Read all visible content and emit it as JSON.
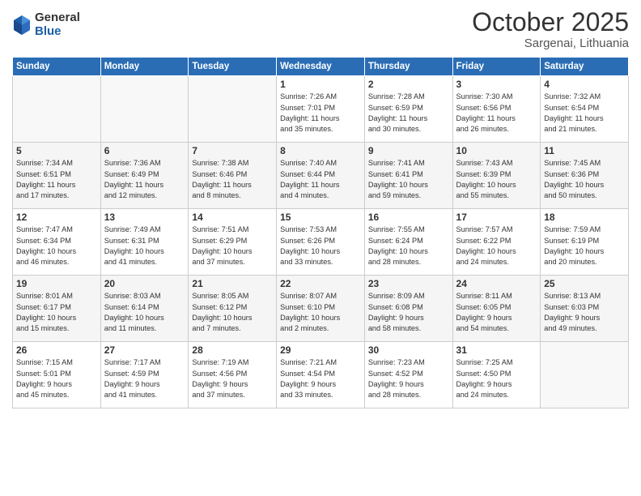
{
  "header": {
    "logo_general": "General",
    "logo_blue": "Blue",
    "month_title": "October 2025",
    "location": "Sargenai, Lithuania"
  },
  "days_of_week": [
    "Sunday",
    "Monday",
    "Tuesday",
    "Wednesday",
    "Thursday",
    "Friday",
    "Saturday"
  ],
  "weeks": [
    [
      {
        "day": "",
        "info": ""
      },
      {
        "day": "",
        "info": ""
      },
      {
        "day": "",
        "info": ""
      },
      {
        "day": "1",
        "info": "Sunrise: 7:26 AM\nSunset: 7:01 PM\nDaylight: 11 hours\nand 35 minutes."
      },
      {
        "day": "2",
        "info": "Sunrise: 7:28 AM\nSunset: 6:59 PM\nDaylight: 11 hours\nand 30 minutes."
      },
      {
        "day": "3",
        "info": "Sunrise: 7:30 AM\nSunset: 6:56 PM\nDaylight: 11 hours\nand 26 minutes."
      },
      {
        "day": "4",
        "info": "Sunrise: 7:32 AM\nSunset: 6:54 PM\nDaylight: 11 hours\nand 21 minutes."
      }
    ],
    [
      {
        "day": "5",
        "info": "Sunrise: 7:34 AM\nSunset: 6:51 PM\nDaylight: 11 hours\nand 17 minutes."
      },
      {
        "day": "6",
        "info": "Sunrise: 7:36 AM\nSunset: 6:49 PM\nDaylight: 11 hours\nand 12 minutes."
      },
      {
        "day": "7",
        "info": "Sunrise: 7:38 AM\nSunset: 6:46 PM\nDaylight: 11 hours\nand 8 minutes."
      },
      {
        "day": "8",
        "info": "Sunrise: 7:40 AM\nSunset: 6:44 PM\nDaylight: 11 hours\nand 4 minutes."
      },
      {
        "day": "9",
        "info": "Sunrise: 7:41 AM\nSunset: 6:41 PM\nDaylight: 10 hours\nand 59 minutes."
      },
      {
        "day": "10",
        "info": "Sunrise: 7:43 AM\nSunset: 6:39 PM\nDaylight: 10 hours\nand 55 minutes."
      },
      {
        "day": "11",
        "info": "Sunrise: 7:45 AM\nSunset: 6:36 PM\nDaylight: 10 hours\nand 50 minutes."
      }
    ],
    [
      {
        "day": "12",
        "info": "Sunrise: 7:47 AM\nSunset: 6:34 PM\nDaylight: 10 hours\nand 46 minutes."
      },
      {
        "day": "13",
        "info": "Sunrise: 7:49 AM\nSunset: 6:31 PM\nDaylight: 10 hours\nand 41 minutes."
      },
      {
        "day": "14",
        "info": "Sunrise: 7:51 AM\nSunset: 6:29 PM\nDaylight: 10 hours\nand 37 minutes."
      },
      {
        "day": "15",
        "info": "Sunrise: 7:53 AM\nSunset: 6:26 PM\nDaylight: 10 hours\nand 33 minutes."
      },
      {
        "day": "16",
        "info": "Sunrise: 7:55 AM\nSunset: 6:24 PM\nDaylight: 10 hours\nand 28 minutes."
      },
      {
        "day": "17",
        "info": "Sunrise: 7:57 AM\nSunset: 6:22 PM\nDaylight: 10 hours\nand 24 minutes."
      },
      {
        "day": "18",
        "info": "Sunrise: 7:59 AM\nSunset: 6:19 PM\nDaylight: 10 hours\nand 20 minutes."
      }
    ],
    [
      {
        "day": "19",
        "info": "Sunrise: 8:01 AM\nSunset: 6:17 PM\nDaylight: 10 hours\nand 15 minutes."
      },
      {
        "day": "20",
        "info": "Sunrise: 8:03 AM\nSunset: 6:14 PM\nDaylight: 10 hours\nand 11 minutes."
      },
      {
        "day": "21",
        "info": "Sunrise: 8:05 AM\nSunset: 6:12 PM\nDaylight: 10 hours\nand 7 minutes."
      },
      {
        "day": "22",
        "info": "Sunrise: 8:07 AM\nSunset: 6:10 PM\nDaylight: 10 hours\nand 2 minutes."
      },
      {
        "day": "23",
        "info": "Sunrise: 8:09 AM\nSunset: 6:08 PM\nDaylight: 9 hours\nand 58 minutes."
      },
      {
        "day": "24",
        "info": "Sunrise: 8:11 AM\nSunset: 6:05 PM\nDaylight: 9 hours\nand 54 minutes."
      },
      {
        "day": "25",
        "info": "Sunrise: 8:13 AM\nSunset: 6:03 PM\nDaylight: 9 hours\nand 49 minutes."
      }
    ],
    [
      {
        "day": "26",
        "info": "Sunrise: 7:15 AM\nSunset: 5:01 PM\nDaylight: 9 hours\nand 45 minutes."
      },
      {
        "day": "27",
        "info": "Sunrise: 7:17 AM\nSunset: 4:59 PM\nDaylight: 9 hours\nand 41 minutes."
      },
      {
        "day": "28",
        "info": "Sunrise: 7:19 AM\nSunset: 4:56 PM\nDaylight: 9 hours\nand 37 minutes."
      },
      {
        "day": "29",
        "info": "Sunrise: 7:21 AM\nSunset: 4:54 PM\nDaylight: 9 hours\nand 33 minutes."
      },
      {
        "day": "30",
        "info": "Sunrise: 7:23 AM\nSunset: 4:52 PM\nDaylight: 9 hours\nand 28 minutes."
      },
      {
        "day": "31",
        "info": "Sunrise: 7:25 AM\nSunset: 4:50 PM\nDaylight: 9 hours\nand 24 minutes."
      },
      {
        "day": "",
        "info": ""
      }
    ]
  ]
}
